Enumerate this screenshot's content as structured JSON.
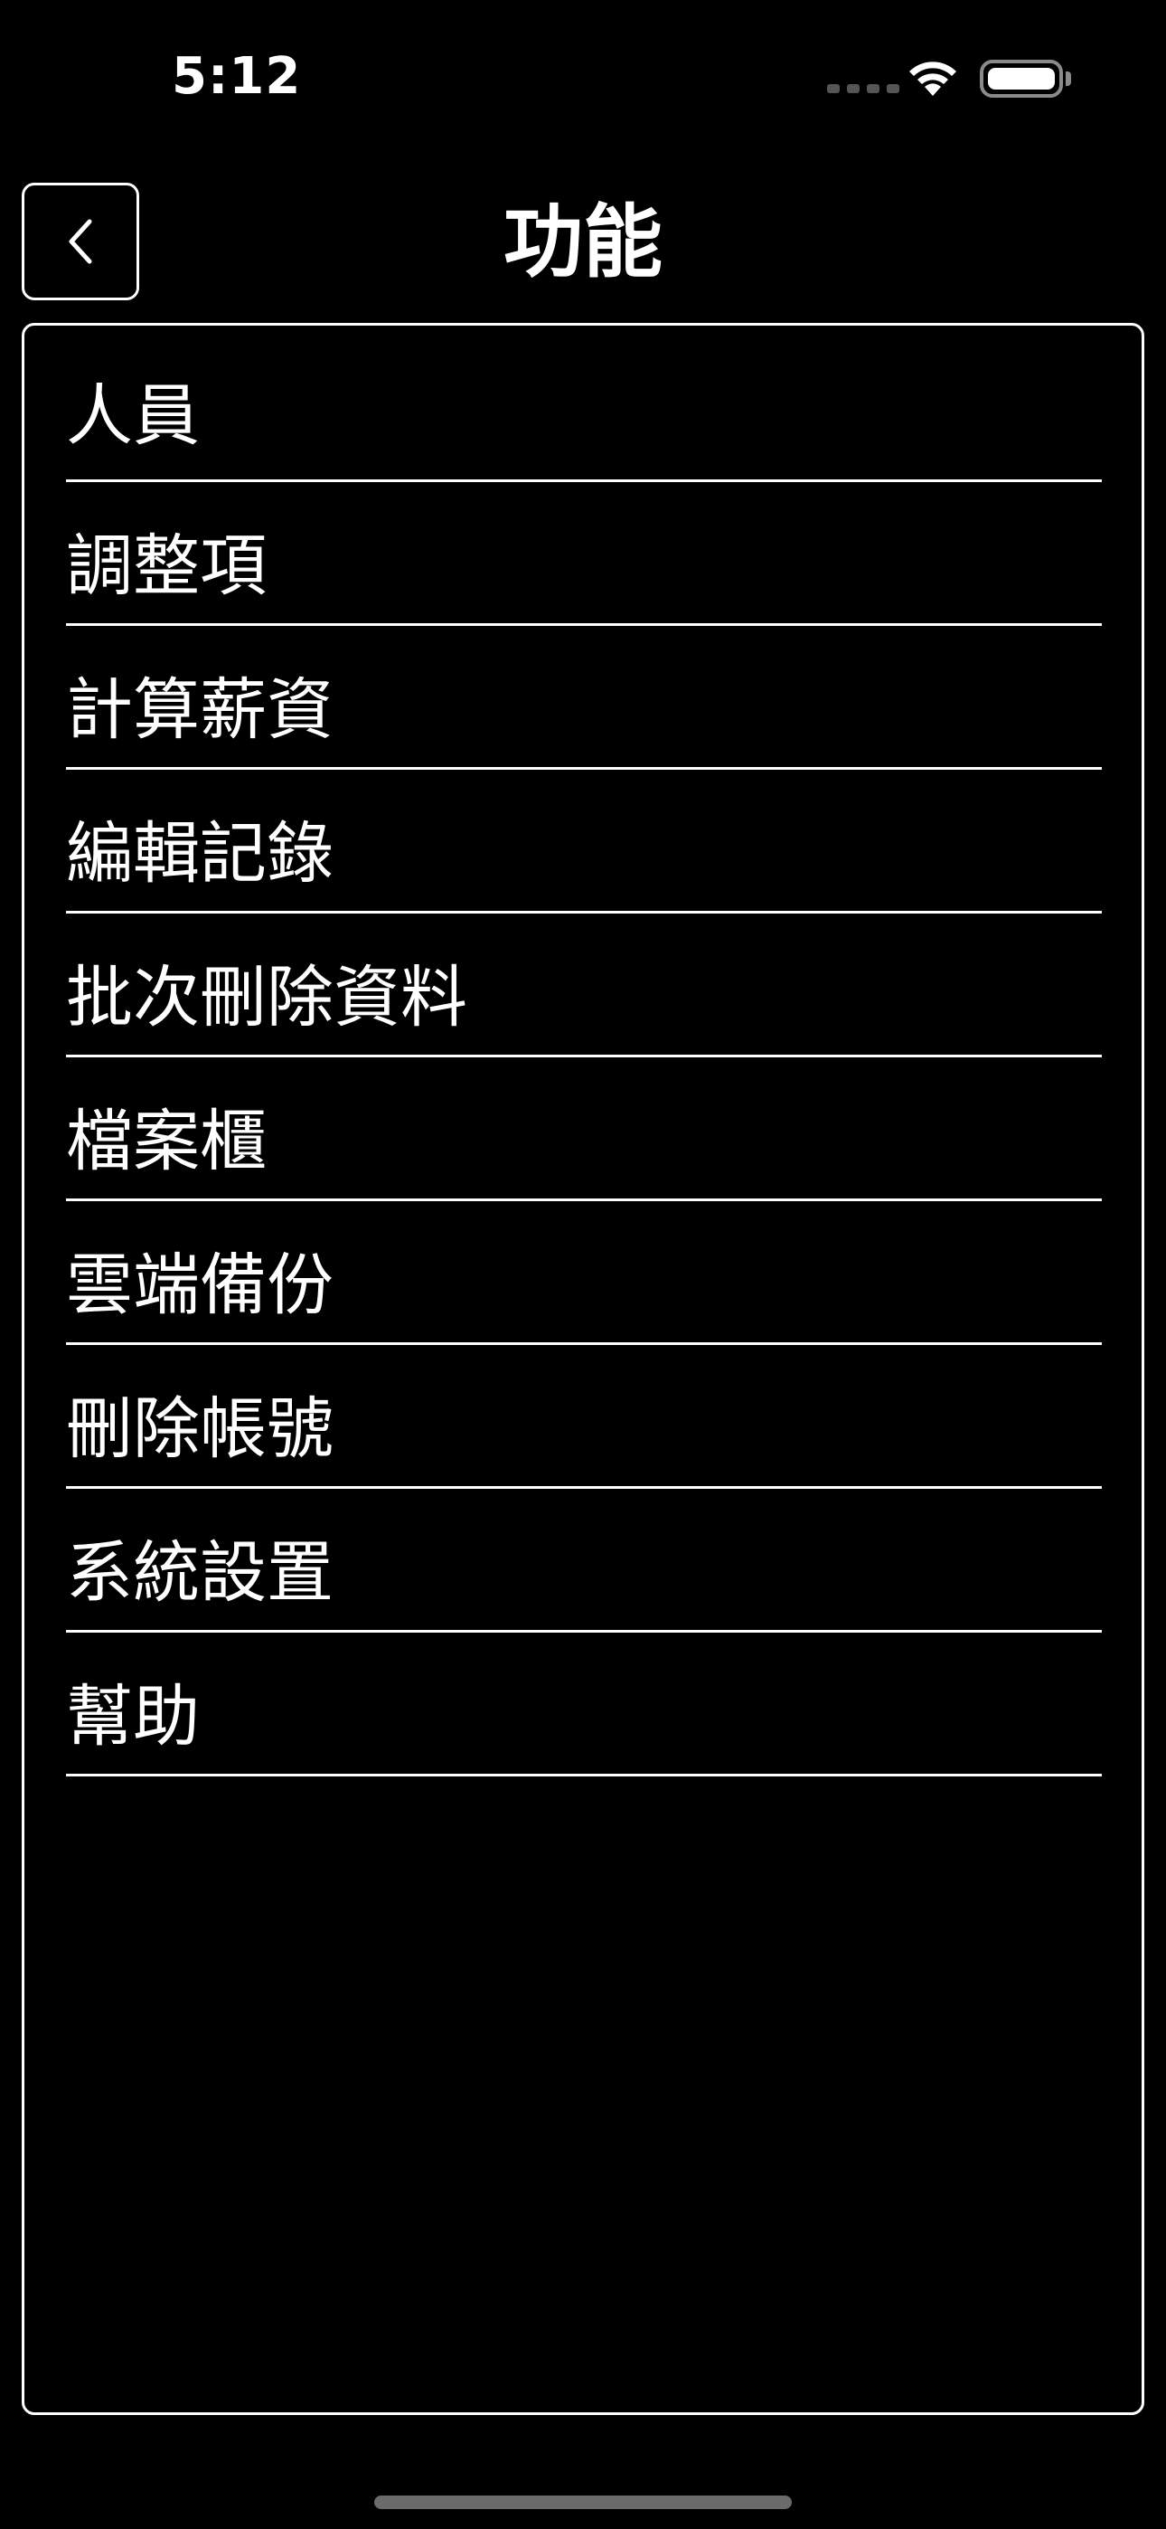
{
  "status_bar": {
    "time": "5:12"
  },
  "header": {
    "title": "功能",
    "back_icon": "chevron-left-icon"
  },
  "menu": {
    "items": [
      {
        "label": "人員"
      },
      {
        "label": "調整項"
      },
      {
        "label": "計算薪資"
      },
      {
        "label": "編輯記錄"
      },
      {
        "label": "批次刪除資料"
      },
      {
        "label": "檔案櫃"
      },
      {
        "label": "雲端備份"
      },
      {
        "label": "刪除帳號"
      },
      {
        "label": "系統設置"
      },
      {
        "label": "幫助"
      }
    ]
  },
  "colors": {
    "background": "#000000",
    "foreground": "#ffffff",
    "inactive": "#555555"
  }
}
